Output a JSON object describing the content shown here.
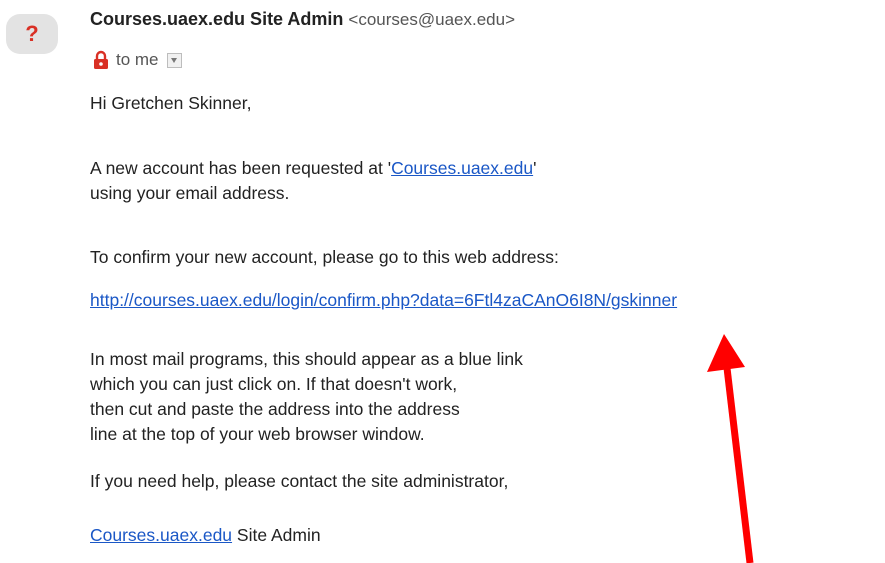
{
  "header": {
    "avatar_glyph": "?",
    "sender_name": "Courses.uaex.edu Site Admin",
    "sender_email": "<courses@uaex.edu>",
    "to_text": "to me"
  },
  "body": {
    "greeting": "Hi Gretchen Skinner,",
    "p1_before": "A new account has been requested at '",
    "p1_link": "Courses.uaex.edu",
    "p1_after": "'",
    "p1_line2": "using your email address.",
    "p2": "To confirm your new account, please go to this web address:",
    "confirm_url": "http://courses.uaex.edu/login/confirm.php?data=6Ftl4zaCAnO6I8N/gskinner",
    "p3_lines": [
      "In most mail programs, this should appear as a blue link",
      "which you can just click on. If that doesn't work,",
      "then cut and paste the address into the address",
      "line at the top of your web browser window."
    ],
    "p4": "If you need help, please contact the site administrator,",
    "sig_link": "Courses.uaex.edu",
    "sig_rest": " Site Admin"
  },
  "colors": {
    "link": "#1a57c6",
    "arrow": "#ff0000",
    "lock": "#d93025"
  }
}
